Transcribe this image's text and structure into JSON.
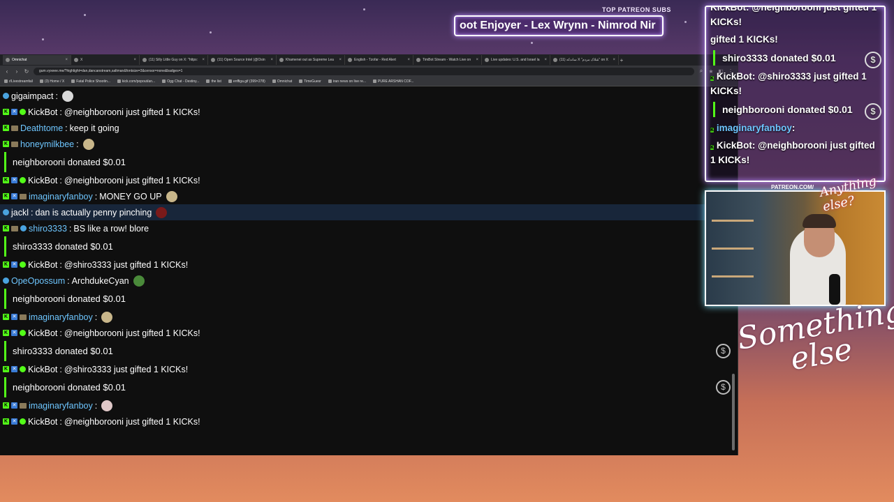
{
  "patreon": {
    "header": "TOP PATREON SUBS",
    "ticker": "oot Enjoyer - Lex Wrynn - Nimrod Nir",
    "url": "PATREON.COM/",
    "brand": "Anything else?"
  },
  "browser": {
    "tabs": [
      {
        "title": "Omnichat",
        "active": true
      },
      {
        "title": "X"
      },
      {
        "title": "(11) Silly Little Guy on X: \"https:"
      },
      {
        "title": "(11) Open Source Intel (@Osin"
      },
      {
        "title": "Khamenei out as Supreme Lea"
      },
      {
        "title": "English - Tzofar - Red Alert"
      },
      {
        "title": "TimBot Stream - Watch Live on"
      },
      {
        "title": "Live updates: U.S. and Israel la"
      },
      {
        "title": "(11) ساندکه X \"شلاک مردم\" on X"
      }
    ],
    "url": "gum.vyxeee.me/?highlight=dan,dancanstream,saltman&fontsize=3&censor=none&badges=1",
    "bookmarks": [
      "r/Livestreamfail",
      "(3) Home / X",
      "Fatal Police Shootin...",
      "kick.com/popout/an...",
      "Ogg Chat - Destiny...",
      "the list",
      "enffiga.gif (399×278)",
      "Omnichat",
      "TimeGuesr",
      "iran news on live re...",
      "PURE ARSHAN COF..."
    ]
  },
  "chat": {
    "messages": [
      {
        "kind": "msg",
        "user": "gigaimpact",
        "user_color": "#ffffff",
        "text": "",
        "emote": "#d8d8d8",
        "badges": [
          "plat"
        ]
      },
      {
        "kind": "msg",
        "user": "KickBot",
        "user_color": "#ffffff",
        "text": "@neighborooni just gifted 1 KICKs!",
        "badges": [
          "k",
          "x",
          "bot"
        ]
      },
      {
        "kind": "msg",
        "user": "Deathtome",
        "user_color": "#6ec6ff",
        "text": "keep it going",
        "badges": [
          "k",
          "img"
        ]
      },
      {
        "kind": "msg",
        "user": "honeymilkbee",
        "user_color": "#6ec6ff",
        "text": "",
        "emote": "#c8b68a",
        "badges": [
          "k",
          "img"
        ]
      },
      {
        "kind": "donation",
        "text": "neighborooni donated $0.01"
      },
      {
        "kind": "msg",
        "user": "KickBot",
        "user_color": "#ffffff",
        "text": "@neighborooni just gifted 1 KICKs!",
        "badges": [
          "k",
          "x",
          "bot"
        ]
      },
      {
        "kind": "msg",
        "user": "imaginaryfanboy",
        "user_color": "#6ec6ff",
        "text": "MONEY GO UP",
        "emote": "#c8b68a",
        "badges": [
          "k",
          "x",
          "img"
        ]
      },
      {
        "kind": "msg",
        "highlight": true,
        "user": "jackl",
        "user_color": "#ffffff",
        "text": "dan is actually penny pinching",
        "emote": "#7a1a1a",
        "badges": [
          "plat"
        ]
      },
      {
        "kind": "msg",
        "user": "shiro3333",
        "user_color": "#6ec6ff",
        "text": "BS like a row! blore",
        "badges": [
          "k",
          "img",
          "plat"
        ]
      },
      {
        "kind": "donation",
        "text": "shiro3333 donated $0.01"
      },
      {
        "kind": "msg",
        "user": "KickBot",
        "user_color": "#ffffff",
        "text": "@shiro3333 just gifted 1 KICKs!",
        "badges": [
          "k",
          "x",
          "bot"
        ]
      },
      {
        "kind": "msg",
        "user": "OpeOpossum",
        "user_color": "#6ec6ff",
        "text": "ArchdukeCyan",
        "emote": "#4a8a3a",
        "badges": [
          "plat"
        ]
      },
      {
        "kind": "donation",
        "text": "neighborooni donated $0.01",
        "coin": true
      },
      {
        "kind": "msg",
        "user": "imaginaryfanboy",
        "user_color": "#6ec6ff",
        "text": "",
        "emote": "#c8b68a",
        "badges": [
          "k",
          "x",
          "img"
        ]
      },
      {
        "kind": "msg",
        "user": "KickBot",
        "user_color": "#ffffff",
        "text": "@neighborooni just gifted 1 KICKs!",
        "badges": [
          "k",
          "x",
          "bot"
        ]
      },
      {
        "kind": "donation",
        "text": "shiro3333 donated $0.01",
        "coin": true
      },
      {
        "kind": "msg",
        "user": "KickBot",
        "user_color": "#ffffff",
        "text": "@shiro3333 just gifted 1 KICKs!",
        "badges": [
          "k",
          "x",
          "bot"
        ]
      },
      {
        "kind": "donation",
        "text": "neighborooni donated $0.01",
        "coin": true
      },
      {
        "kind": "msg",
        "user": "imaginaryfanboy",
        "user_color": "#6ec6ff",
        "text": "",
        "emote": "#e0c8c8",
        "badges": [
          "k",
          "x",
          "img"
        ]
      },
      {
        "kind": "msg",
        "user": "KickBot",
        "user_color": "#ffffff",
        "text": "@neighborooni just gifted 1 KICKs!",
        "badges": [
          "k",
          "x",
          "bot"
        ]
      }
    ]
  },
  "overlay": {
    "top_cut": "KickBot: @neighborooni just gifted 1 KICKs!",
    "items": [
      {
        "kind": "msg",
        "text": "gifted 1 KICKs!"
      },
      {
        "kind": "donation",
        "text": "shiro3333 donated $0.01"
      },
      {
        "kind": "msg",
        "user": "KickBot",
        "text": "@shiro3333 just gifted 1 KICKs!"
      },
      {
        "kind": "donation",
        "text": "neighborooni donated $0.01"
      },
      {
        "kind": "msg",
        "user": "imaginaryfanboy",
        "user_color": "#6ec6ff",
        "text": ""
      },
      {
        "kind": "msg",
        "user": "KickBot",
        "text": "@neighborooni just gifted 1 KICKs!"
      }
    ]
  },
  "branding": {
    "something_else_l1": "Something",
    "something_else_l2": "else"
  },
  "colors": {
    "kick_green": "#53fc18",
    "username_blue": "#6ec6ff",
    "chat_bg": "#0f0f0f",
    "neon_border": "#b98cff"
  }
}
